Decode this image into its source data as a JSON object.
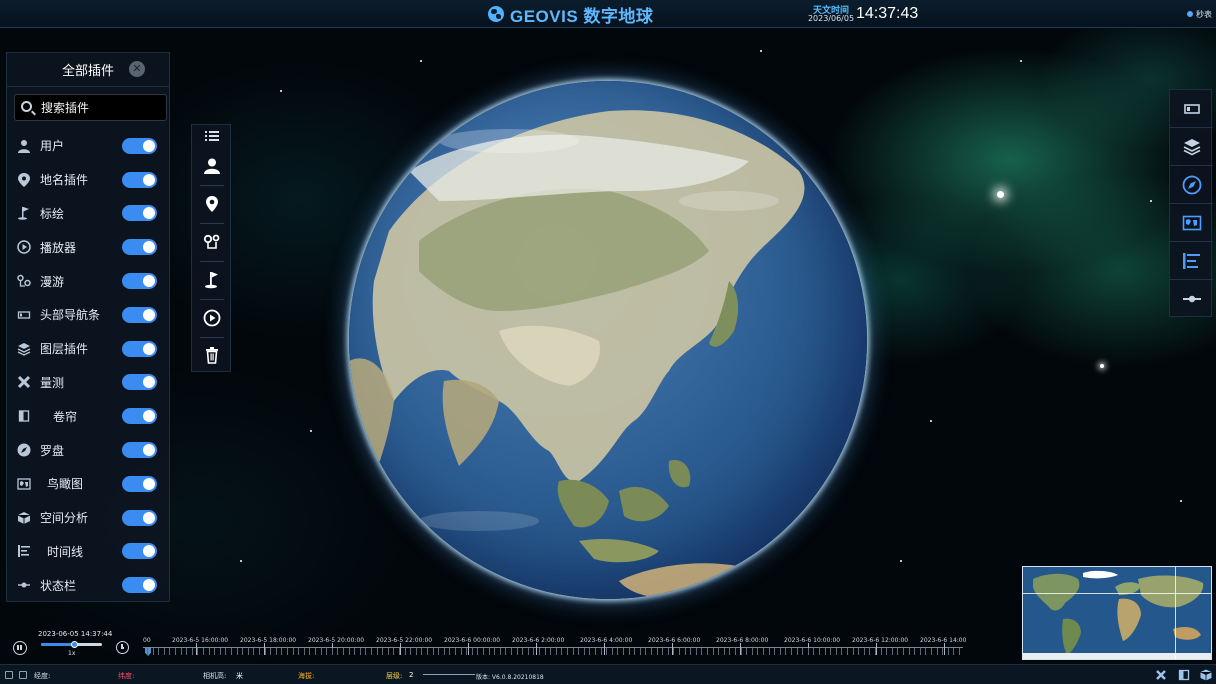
{
  "header": {
    "brand": "GEOVIS 数字地球",
    "clock_label": "天文时间",
    "date": "2023/06/05",
    "time": "14:37:43",
    "seconds_label": "秒表"
  },
  "plugin_panel": {
    "title": "全部插件",
    "search_placeholder": "搜索插件",
    "items": [
      {
        "label": "用户",
        "icon": "user-icon",
        "enabled": true
      },
      {
        "label": "地名插件",
        "icon": "map-pin-icon",
        "enabled": true
      },
      {
        "label": "标绘",
        "icon": "flag-icon",
        "enabled": true
      },
      {
        "label": "播放器",
        "icon": "play-circle-icon",
        "enabled": true
      },
      {
        "label": "漫游",
        "icon": "route-icon",
        "enabled": true
      },
      {
        "label": "头部导航条",
        "icon": "navbar-icon",
        "enabled": true
      },
      {
        "label": "图层插件",
        "icon": "layers-icon",
        "enabled": true
      },
      {
        "label": "量测",
        "icon": "measure-icon",
        "enabled": true
      },
      {
        "label": "卷帘",
        "icon": "curtain-icon",
        "enabled": true
      },
      {
        "label": "罗盘",
        "icon": "compass-icon",
        "enabled": true
      },
      {
        "label": "鸟瞰图",
        "icon": "overview-map-icon",
        "enabled": true
      },
      {
        "label": "空间分析",
        "icon": "cube-icon",
        "enabled": true
      },
      {
        "label": "时间线",
        "icon": "timeline-icon",
        "enabled": true
      },
      {
        "label": "状态栏",
        "icon": "statusbar-icon",
        "enabled": true
      }
    ]
  },
  "left_tools": [
    "list-icon",
    "user-icon",
    "map-pin-icon",
    "route-icon",
    "flag-icon",
    "play-circle-icon",
    "trash-icon"
  ],
  "right_tools": [
    "navbar-icon",
    "layers-icon",
    "compass-icon",
    "overview-map-icon",
    "timeline-icon",
    "statusbar-icon"
  ],
  "timeline": {
    "current": "2023-06-05 14:37:44",
    "speed": "1x",
    "speed_position": 0.55,
    "ticks": [
      "00",
      "2023-6-5 16:00:00",
      "2023-6-5 18:00:00",
      "2023-6-5 20:00:00",
      "2023-6-5 22:00:00",
      "2023-6-6 00:00:00",
      "2023-6-6 2:00:00",
      "2023-6-6 4:00:00",
      "2023-6-6 6:00:00",
      "2023-6-6 8:00:00",
      "2023-6-6 10:00:00",
      "2023-6-6 12:00:00",
      "2023-6-6 14:00"
    ]
  },
  "statusbar": {
    "lon_label": "经度:",
    "lat_label": "纬度:",
    "cam_label": "相机高:",
    "cam_unit": "米",
    "alt_label": "海拔:",
    "level_label": "层级:",
    "level_value": "2",
    "version": "版本: V6.0.8.20210818"
  },
  "colors": {
    "accent": "#3b8cf0",
    "brand": "#5fb8ff",
    "lat_label": "#ff4d6d",
    "alt_label": "#ffb020",
    "level_label": "#ffd84d"
  }
}
